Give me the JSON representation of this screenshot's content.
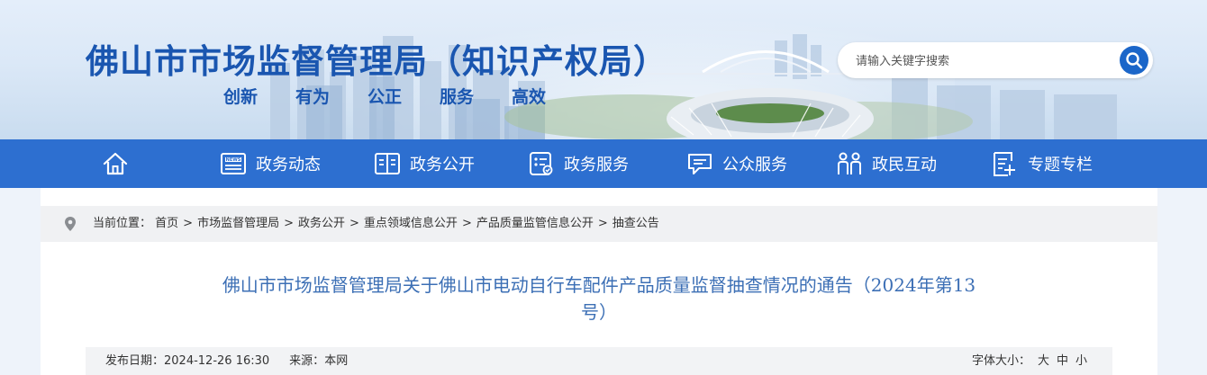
{
  "header": {
    "site_title": "佛山市市场监督管理局（知识产权局）",
    "slogan": [
      "创新",
      "有为",
      "公正",
      "服务",
      "高效"
    ]
  },
  "search": {
    "placeholder": "请输入关键字搜索"
  },
  "nav": {
    "items": [
      {
        "label": "政务动态",
        "icon": "news-icon"
      },
      {
        "label": "政务公开",
        "icon": "book-icon"
      },
      {
        "label": "政务服务",
        "icon": "service-list-icon"
      },
      {
        "label": "公众服务",
        "icon": "chat-bubble-icon"
      },
      {
        "label": "政民互动",
        "icon": "people-icon"
      },
      {
        "label": "专题专栏",
        "icon": "document-edit-icon"
      }
    ]
  },
  "breadcrumb": {
    "prefix": "当前位置：",
    "items": [
      "首页",
      "市场监督管理局",
      "政务公开",
      "重点领域信息公开",
      "产品质量监管信息公开",
      "抽查公告"
    ],
    "separator": ">"
  },
  "article": {
    "title_line1": "佛山市市场监督管理局关于佛山市电动自行车配件产品质量监督抽查情况的通告（2024年第13",
    "title_line2": "号）",
    "publish_label": "发布日期：",
    "publish_date": "2024-12-26 16:30",
    "source_label": "来源：",
    "source": "本网",
    "font_size_label": "字体大小：",
    "font_sizes": [
      "大",
      "中",
      "小"
    ]
  },
  "colors": {
    "brand_blue": "#1a56b0",
    "nav_blue": "#2d6fd0",
    "title_blue": "#3c6fb5"
  }
}
